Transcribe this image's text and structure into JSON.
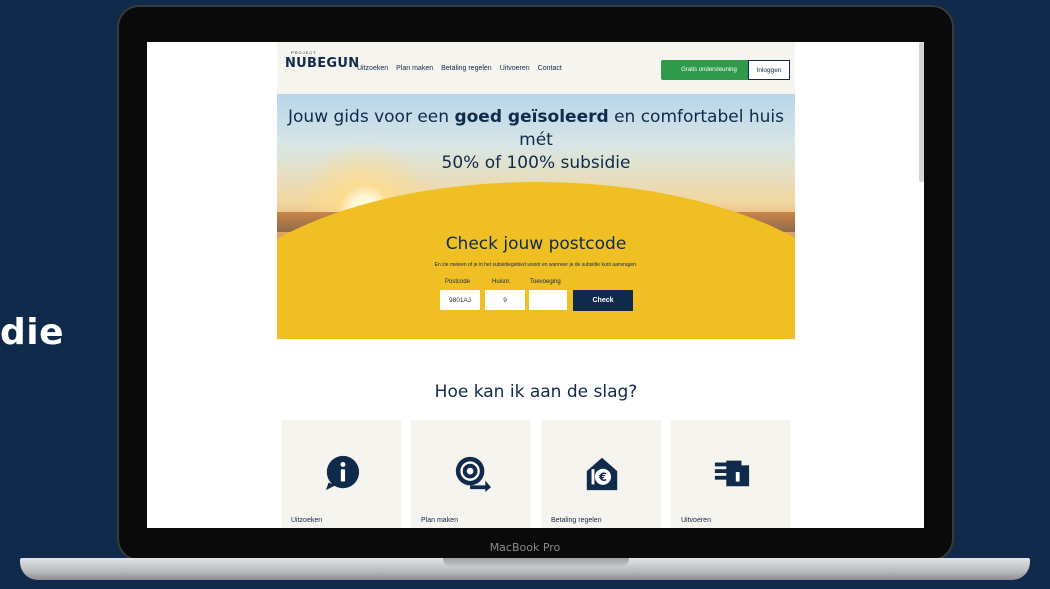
{
  "side_text": "die",
  "device_label": "MacBook Pro",
  "site": {
    "logo_top": "PROJECT",
    "logo": "NUBEGUN",
    "nav": [
      "Uitzoeken",
      "Plan maken",
      "Betaling regelen",
      "Uitvoeren",
      "Contact"
    ],
    "support_button": "Gratis ondersteuning",
    "login_button": "Inloggen",
    "hero": {
      "title_pre": "Jouw gids voor een ",
      "title_bold": "goed geïsoleerd",
      "title_post": " en comfortabel huis mét",
      "title_line2": "50% of 100% subsidie"
    },
    "check": {
      "title": "Check jouw postcode",
      "subtitle": "En zie meteen of je in het subsidiegebied woont en wanneer je de subsidie kunt aanvragen.",
      "postcode_label": "Postcode",
      "huisnr_label": "Huisnr.",
      "toevoeging_label": "Toevoeging",
      "postcode_value": "9801AJ",
      "huisnr_value": "9",
      "toevoeging_value": "",
      "button": "Check"
    },
    "how": {
      "title": "Hoe kan ik aan de slag?",
      "cards": [
        "Uitzoeken",
        "Plan maken",
        "Betaling regelen",
        "Uitvoeren"
      ]
    }
  },
  "colors": {
    "background": "#0f2a4a",
    "brand_navy": "#0f2a4a",
    "hero_yellow": "#f0bf23",
    "support_green": "#2f9a4a",
    "card_bg": "#f6f4ee"
  },
  "icons": [
    "info-bubble-icon",
    "spiral-arrow-icon",
    "euro-house-icon",
    "hand-icon"
  ]
}
